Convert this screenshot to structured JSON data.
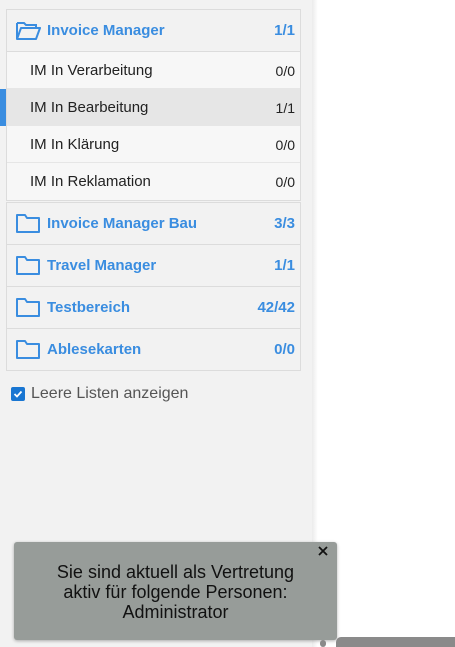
{
  "accent_color": "#3a8de0",
  "groups": [
    {
      "title": "Invoice Manager",
      "count": "1/1",
      "expanded": true,
      "icon": "folder-open-icon",
      "items": [
        {
          "label": "IM In Verarbeitung",
          "count": "0/0"
        },
        {
          "label": "IM In Bearbeitung",
          "count": "1/1",
          "active": true
        },
        {
          "label": "IM In Klärung",
          "count": "0/0"
        },
        {
          "label": "IM In Reklamation",
          "count": "0/0"
        }
      ]
    },
    {
      "title": "Invoice Manager Bau",
      "count": "3/3",
      "icon": "folder-icon"
    },
    {
      "title": "Travel Manager",
      "count": "1/1",
      "icon": "folder-icon"
    },
    {
      "title": "Testbereich",
      "count": "42/42",
      "icon": "folder-icon"
    },
    {
      "title": "Ablesekarten",
      "count": "0/0",
      "icon": "folder-icon"
    }
  ],
  "show_empty_lists": {
    "label": "Leere Listen anzeigen",
    "checked": true
  },
  "toast": {
    "line1": "Sie sind aktuell als Vertretung",
    "line2": "aktiv für folgende Personen:",
    "line3": "Administrator",
    "close_icon": "close-icon"
  }
}
